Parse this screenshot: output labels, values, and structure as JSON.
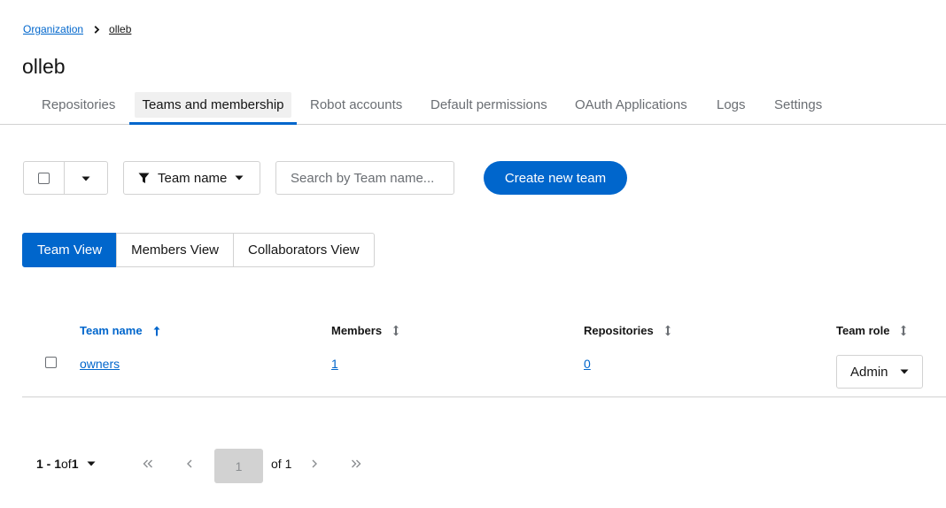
{
  "breadcrumb": {
    "root": "Organization",
    "current": "olleb"
  },
  "page": {
    "title": "olleb"
  },
  "tabs": [
    {
      "label": "Repositories"
    },
    {
      "label": "Teams and membership"
    },
    {
      "label": "Robot accounts"
    },
    {
      "label": "Default permissions"
    },
    {
      "label": "OAuth Applications"
    },
    {
      "label": "Logs"
    },
    {
      "label": "Settings"
    }
  ],
  "active_tab": "Teams and membership",
  "toolbar": {
    "filter_label": "Team name",
    "search_placeholder": "Search by Team name...",
    "create_label": "Create new team"
  },
  "views": [
    {
      "label": "Team View"
    },
    {
      "label": "Members View"
    },
    {
      "label": "Collaborators View"
    }
  ],
  "active_view": "Team View",
  "table": {
    "headers": {
      "team_name": "Team name",
      "members": "Members",
      "repositories": "Repositories",
      "team_role": "Team role"
    },
    "rows": [
      {
        "team_name": "owners",
        "members": "1",
        "repositories": "0",
        "team_role": "Admin"
      }
    ]
  },
  "pagination": {
    "range": "1 - 1",
    "of_word": "of",
    "total": "1",
    "page": "1",
    "of_pages": "of 1"
  },
  "colors": {
    "accent": "#0066cc",
    "border": "#d2d2d2",
    "muted": "#6a6e73"
  }
}
